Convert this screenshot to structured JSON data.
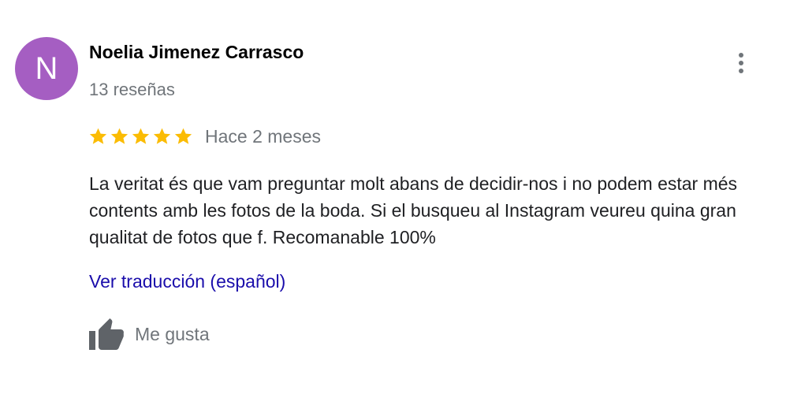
{
  "review": {
    "avatar_initial": "N",
    "avatar_color": "#a55ec2",
    "author_name": "Noelia Jimenez Carrasco",
    "review_count": "13 reseñas",
    "more_options_icon": "more-vert-icon",
    "rating": 5,
    "rating_max": 5,
    "star_color": "#fbbc04",
    "date": "Hace 2 meses",
    "text": "La veritat és que vam preguntar molt abans de decidir-nos i no podem estar més contents amb les fotos de la boda. Si el busqueu al Instagram veureu quina gran qualitat de fotos que f. Recomanable 100%",
    "translate_link": "Ver traducción (español)",
    "link_color": "#1a0dab",
    "like_icon": "thumbs-up-icon",
    "like_label": "Me gusta"
  }
}
